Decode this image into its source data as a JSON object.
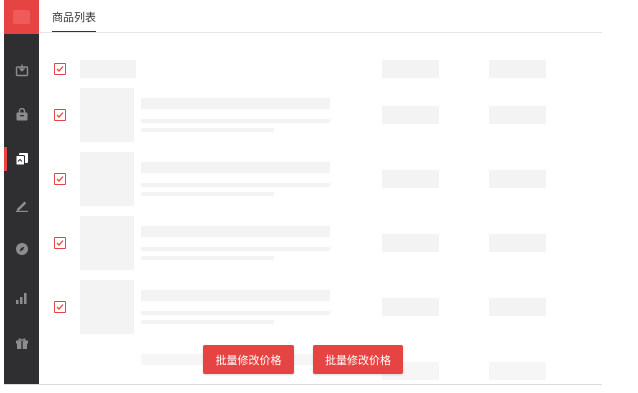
{
  "header": {
    "active_tab": "商品列表"
  },
  "sidebar": {
    "items": [
      {
        "icon": "inbox-download-icon",
        "active": false
      },
      {
        "icon": "shopping-bag-icon",
        "active": false
      },
      {
        "icon": "product-copy-icon",
        "active": true
      },
      {
        "icon": "pen-edit-icon",
        "active": false
      },
      {
        "icon": "compass-icon",
        "active": false
      },
      {
        "icon": "bar-chart-icon",
        "active": false
      },
      {
        "icon": "gift-icon",
        "active": false
      }
    ]
  },
  "list": {
    "header_row_checked": true,
    "rows": [
      {
        "checked": true
      },
      {
        "checked": true
      },
      {
        "checked": true
      },
      {
        "checked": true
      }
    ]
  },
  "actions": {
    "primary_button_label": "批量修改价格",
    "secondary_button_label": "批量修改价格"
  },
  "colors": {
    "accent": "#e64442",
    "sidebar": "#2f2f31",
    "placeholder": "#f3f3f3"
  }
}
